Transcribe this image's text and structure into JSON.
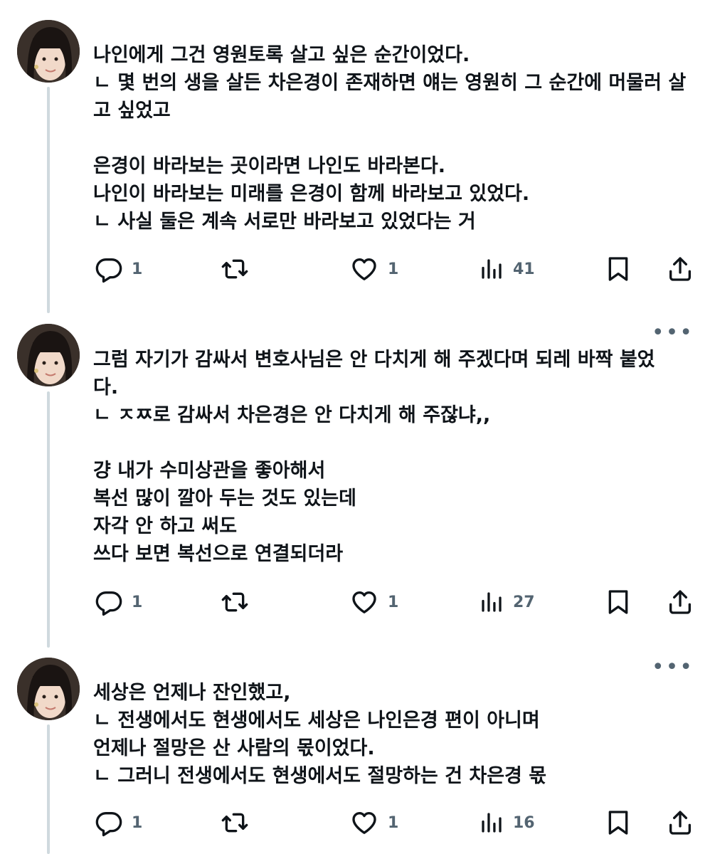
{
  "tweets": [
    {
      "lines": [
        "나인에게 그건 영원토록 살고 싶은 순간이었다.",
        "ㄴ 몇 번의 생을 살든 차은경이 존재하면 얘는 영원히 그 순간에 머물러 살고 싶었고",
        "",
        "은경이 바라보는 곳이라면 나인도 바라본다.",
        "나인이 바라보는 미래를 은경이 함께 바라보고 있었다.",
        "ㄴ 사실 둘은 계속 서로만 바라보고 있었다는 거"
      ],
      "replies": "1",
      "reposts": "",
      "likes": "1",
      "views": "41"
    },
    {
      "more": "•••",
      "lines": [
        "그럼 자기가 감싸서 변호사님은 안 다치게 해 주겠다며 되레 바짝 붙었다.",
        "ㄴ ㅈㅉ로 감싸서 차은경은 안 다치게 해 주잖냐,,",
        "",
        "걍 내가 수미상관을 좋아해서",
        "복선 많이 깔아 두는 것도 있는데",
        "자각 안 하고 써도",
        "쓰다 보면 복선으로 연결되더라"
      ],
      "replies": "1",
      "reposts": "",
      "likes": "1",
      "views": "27"
    },
    {
      "more": "•••",
      "lines": [
        "세상은 언제나 잔인했고,",
        "ㄴ 전생에서도 현생에서도 세상은 나인은경 편이 아니며",
        "언제나 절망은 산 사람의 몫이었다.",
        "ㄴ 그러니 전생에서도 현생에서도 절망하는 건 차은경 몫"
      ],
      "replies": "1",
      "reposts": "",
      "likes": "1",
      "views": "16"
    }
  ],
  "icons": {
    "reply": "reply-icon",
    "repost": "repost-icon",
    "like": "heart-icon",
    "views": "views-icon",
    "bookmark": "bookmark-icon",
    "share": "share-icon"
  },
  "colors": {
    "text": "#0f1419",
    "secondary": "#536471",
    "thread_line": "#cfd9de",
    "background": "#ffffff"
  }
}
